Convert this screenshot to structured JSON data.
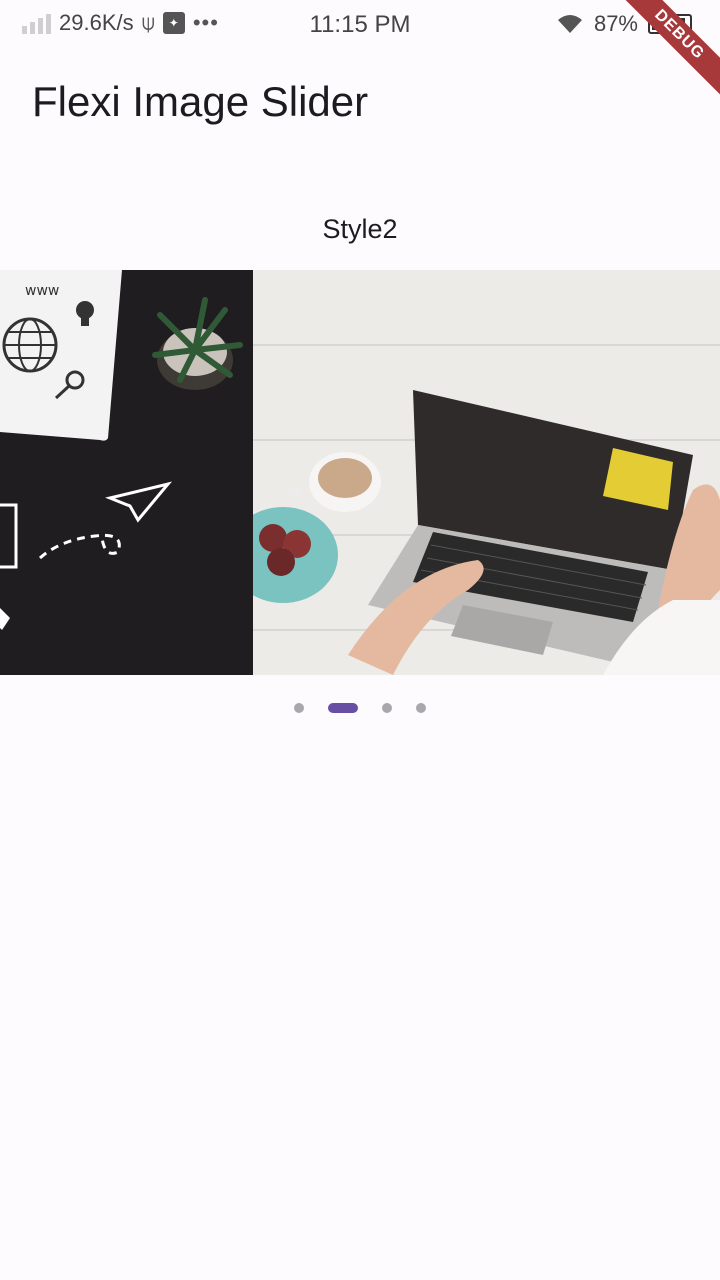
{
  "status_bar": {
    "net_speed": "29.6K/s",
    "time": "11:15 PM",
    "battery": "87%",
    "more_icon": "ellipsis",
    "usb_icon": "usb-icon",
    "wifi_icon": "wifi-icon"
  },
  "debug_banner": "DEBUG",
  "app_bar": {
    "title": "Flexi Image Slider"
  },
  "slider": {
    "caption": "Style2",
    "slides": [
      {
        "image": "workspace-icons-illustration"
      },
      {
        "image": "laptop-on-desk-photo"
      }
    ],
    "indicator": {
      "count": 4,
      "active_index": 1,
      "active_color": "#6750a4",
      "inactive_color": "#a9a7ab"
    }
  }
}
